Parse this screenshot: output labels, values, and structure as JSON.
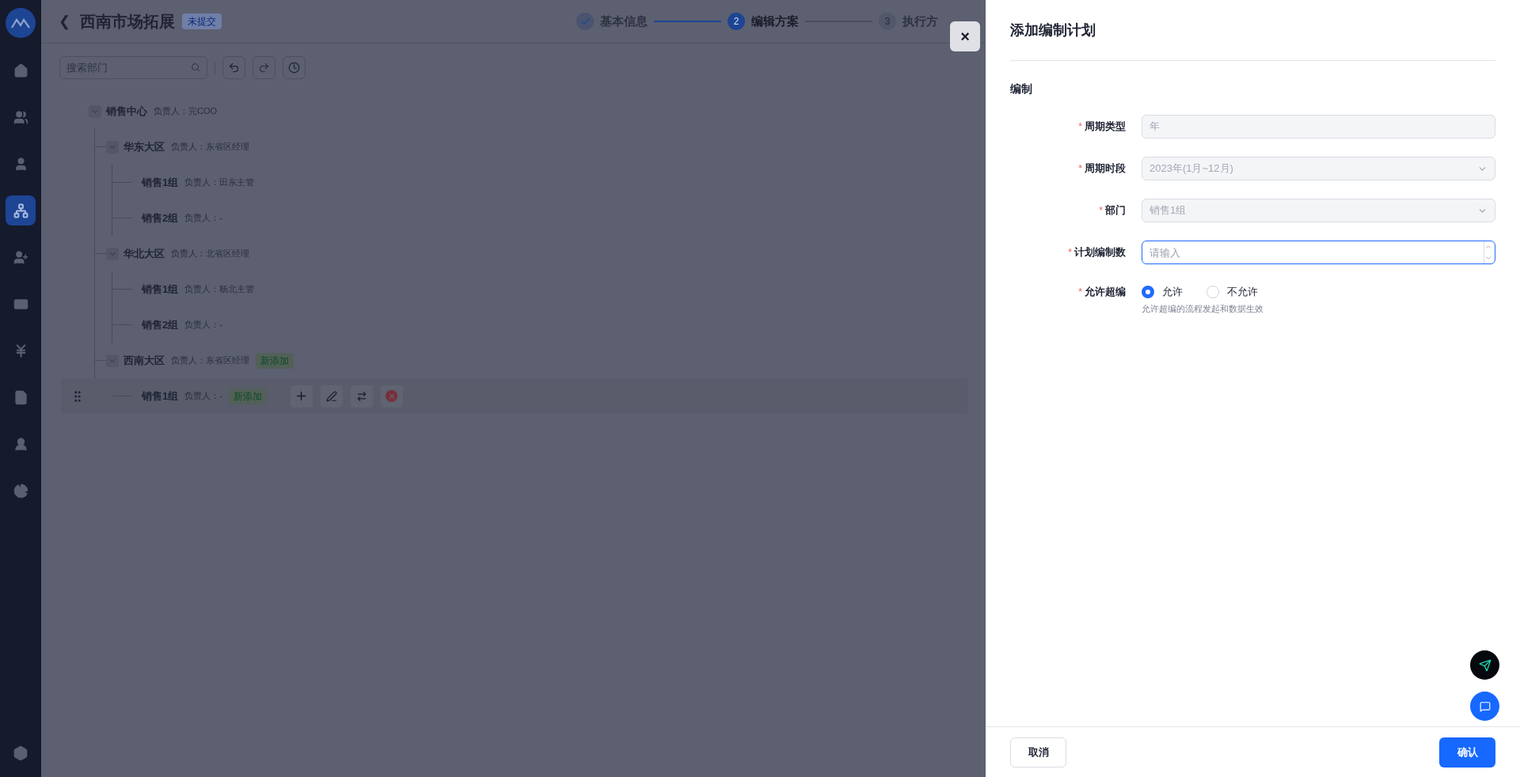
{
  "sidebar": {
    "items": [
      {
        "selected": false
      },
      {
        "selected": false
      },
      {
        "selected": false
      },
      {
        "selected": true
      },
      {
        "selected": false
      },
      {
        "selected": false
      },
      {
        "selected": false
      },
      {
        "selected": false
      },
      {
        "selected": false
      },
      {
        "selected": false
      }
    ]
  },
  "header": {
    "back": "❮",
    "title": "西南市场拓展",
    "status": "未提交"
  },
  "steps": [
    {
      "label": "基本信息",
      "completed": true,
      "selected": false
    },
    {
      "number": "2",
      "label": "编辑方案",
      "completed": false,
      "selected": true
    },
    {
      "number": "3",
      "label": "执行方",
      "completed": false,
      "selected": false
    }
  ],
  "toolbar": {
    "search": {
      "placeholder": "搜索部门"
    }
  },
  "tree": [
    {
      "name": "销售中心",
      "owner": "负责人：完COO",
      "expanded": true,
      "highlighted": false,
      "children": [
        {
          "name": "华东大区",
          "owner": "负责人：东省区经理",
          "expanded": true,
          "highlighted": false,
          "children": [
            {
              "name": "销售1组",
              "owner": "负责人：田东主管",
              "highlighted": false
            },
            {
              "name": "销售2组",
              "owner": "负责人：-",
              "highlighted": false
            }
          ]
        },
        {
          "name": "华北大区",
          "owner": "负责人：北省区经理",
          "expanded": true,
          "highlighted": false,
          "children": [
            {
              "name": "销售1组",
              "owner": "负责人：杨北主管",
              "highlighted": false
            },
            {
              "name": "销售2组",
              "owner": "负责人：-",
              "highlighted": false
            }
          ]
        },
        {
          "name": "西南大区",
          "owner": "负责人：东省区经理",
          "tag": "新添加",
          "expanded": true,
          "highlighted": false,
          "children": [
            {
              "name": "销售1组",
              "owner": "负责人：-",
              "tag": "新添加",
              "highlighted": true
            }
          ]
        }
      ]
    }
  ],
  "drawer": {
    "close": "×",
    "title": "添加编制计划",
    "section": "编制",
    "fields": [
      {
        "kind": "text",
        "label": "周期类型",
        "required_mark": "*",
        "disabled": true,
        "value": "年"
      },
      {
        "kind": "select",
        "label": "周期时段",
        "required_mark": "*",
        "disabled": true,
        "value": "2023年(1月~12月)"
      },
      {
        "kind": "select",
        "label": "部门",
        "required_mark": "*",
        "disabled": true,
        "value": "销售1组"
      },
      {
        "kind": "number",
        "label": "计划编制数",
        "required_mark": "*",
        "disabled": false,
        "focused": true,
        "placeholder": "请输入"
      },
      {
        "kind": "radio",
        "label": "允许超编",
        "required_mark": "*",
        "options": [
          {
            "label": "允许",
            "selected": true
          },
          {
            "label": "不允许",
            "selected": false
          }
        ],
        "hint": "允许超编的流程发起和数据生效"
      }
    ],
    "buttons": [
      {
        "label": "取消",
        "kind": "secondary"
      },
      {
        "label": "确认",
        "kind": "primary"
      }
    ]
  }
}
